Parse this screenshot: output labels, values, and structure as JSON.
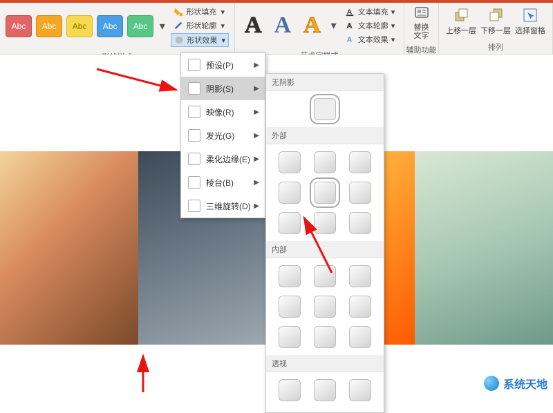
{
  "ribbon": {
    "shape_styles": {
      "label": "形状样式",
      "swatch_text": "Abc",
      "fill": "形状填充",
      "outline": "形状轮廓",
      "effects": "形状效果"
    },
    "wordart": {
      "label": "艺术字样式",
      "sample": "A",
      "fill": "文本填充",
      "outline": "文本轮廓",
      "effects": "文本效果"
    },
    "a11y": {
      "label": "辅助功能",
      "alt": "替换\n文字"
    },
    "arrange": {
      "label": "排列",
      "front": "上移一层",
      "back": "下移一层",
      "pane": "选择窗格"
    }
  },
  "menu": {
    "items": [
      {
        "label": "预设(P)"
      },
      {
        "label": "阴影(S)",
        "selected": true
      },
      {
        "label": "映像(R)"
      },
      {
        "label": "发光(G)"
      },
      {
        "label": "柔化边缘(E)"
      },
      {
        "label": "棱台(B)"
      },
      {
        "label": "三维旋转(D)"
      }
    ]
  },
  "gallery": {
    "none": "无阴影",
    "outer": "外部",
    "inner": "内部",
    "persp": "透视"
  },
  "watermark": "系统天地"
}
